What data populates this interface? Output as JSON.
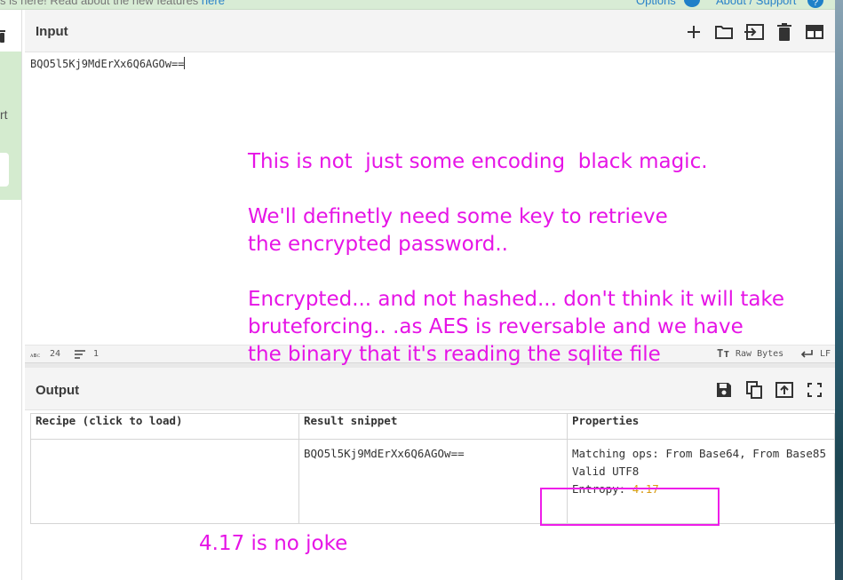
{
  "top_notice": {
    "text": "s is here! Read about the new features ",
    "link": "here"
  },
  "top_links": {
    "options": "Options",
    "about_support": "About / Support"
  },
  "left_panel": {
    "partial_text": "rt"
  },
  "input": {
    "title": "Input",
    "value": "BQO5l5Kj9MdErXx6Q6AGOw==",
    "status": {
      "chars": "24",
      "lines": "1",
      "raw_bytes": "Raw Bytes",
      "eol": "LF"
    }
  },
  "output": {
    "title": "Output",
    "columns": [
      "Recipe (click to load)",
      "Result snippet",
      "Properties"
    ],
    "row": {
      "recipe": "",
      "snippet": "BQO5l5Kj9MdErXx6Q6AGOw==",
      "properties": {
        "matching_ops": "Matching ops: From Base64, From Base85",
        "valid": "Valid UTF8",
        "entropy_label": "Entropy: ",
        "entropy_value": "4.17"
      }
    }
  },
  "annotations": {
    "note_main": "This is not  just some encoding  black magic.\n\nWe'll definetly need some key to retrieve\nthe encrypted password..\n\nEncrypted... and not hashed... don't think it will take\nbruteforcing.. .as AES is reversable and we have\nthe binary that it's reading the sqlite file",
    "note_entropy": "4.17 is no joke"
  },
  "colors": {
    "annotation": "#e614e6",
    "entropy": "#d89a16",
    "accent_blue": "#1f80c8"
  },
  "icons": {
    "input_toolbar": [
      "plus-icon",
      "folder-icon",
      "import-icon",
      "trash-icon",
      "layout-icon"
    ],
    "output_toolbar": [
      "save-icon",
      "copy-icon",
      "export-icon",
      "fullscreen-icon"
    ]
  }
}
